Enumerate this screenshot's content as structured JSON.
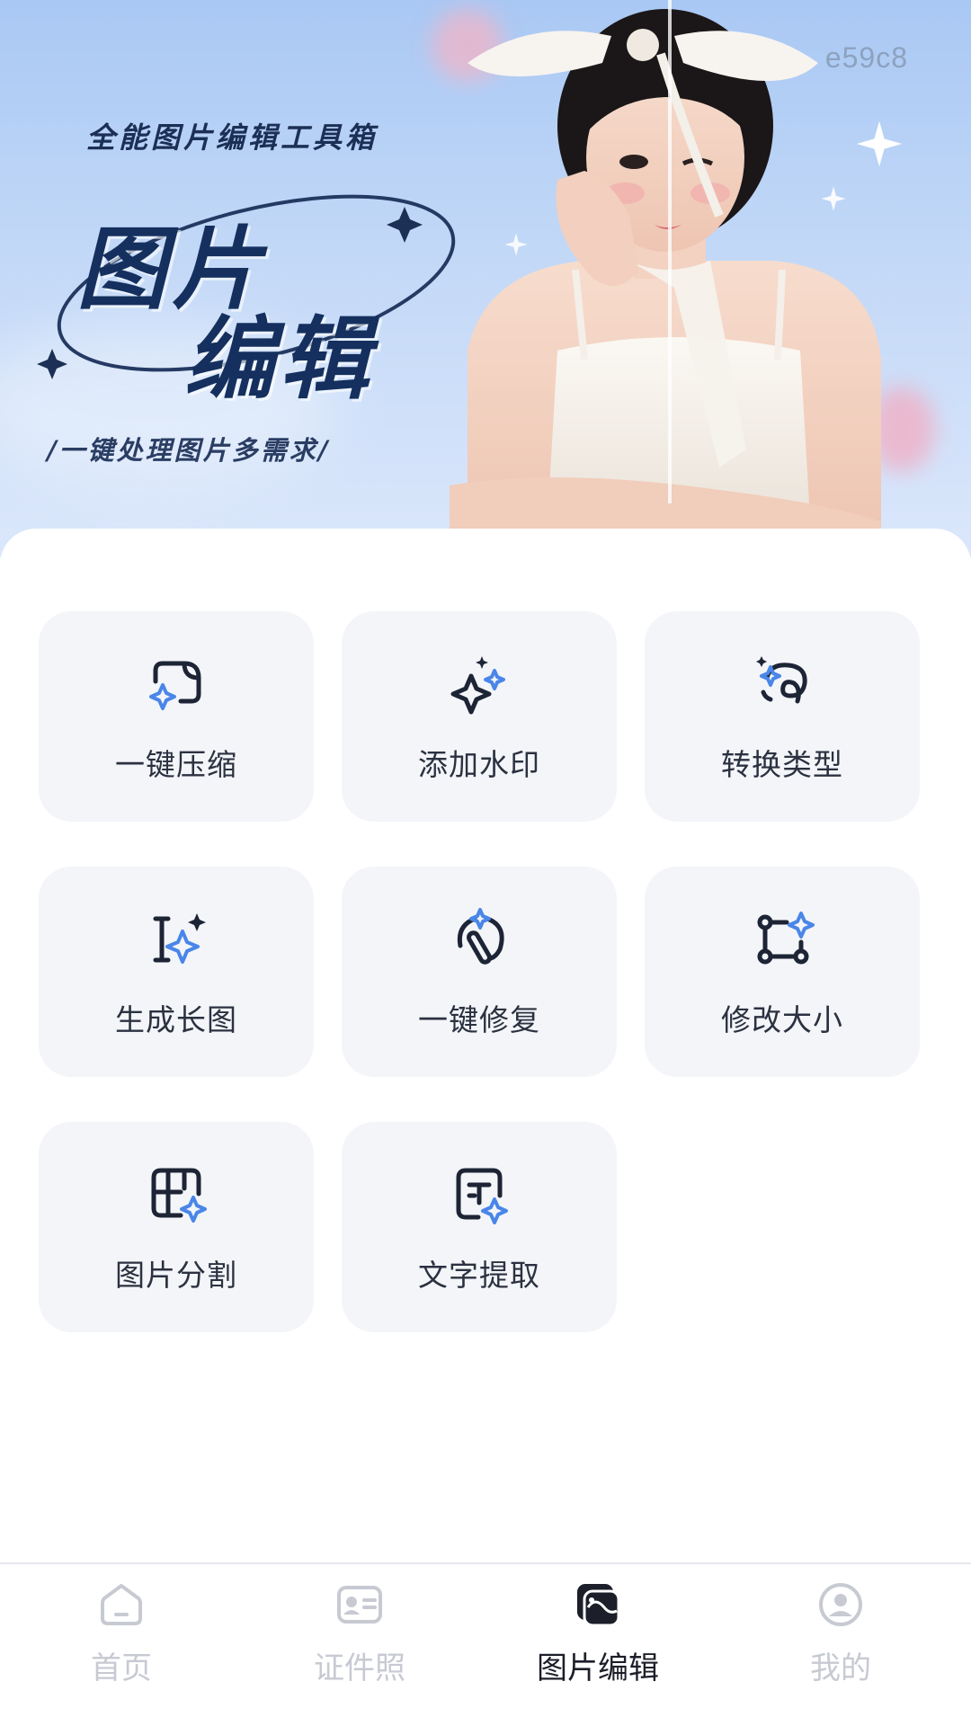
{
  "banner": {
    "code": "e59c8",
    "tagline": "全能图片编辑工具箱",
    "title_line1": "图片",
    "title_line2": "编辑",
    "slogan": "/一键处理图片多需求/"
  },
  "tools": [
    {
      "label": "一键压缩",
      "icon": "compress-icon"
    },
    {
      "label": "添加水印",
      "icon": "watermark-sparkle-icon"
    },
    {
      "label": "转换类型",
      "icon": "convert-icon"
    },
    {
      "label": "生成长图",
      "icon": "long-image-icon"
    },
    {
      "label": "一键修复",
      "icon": "repair-wand-icon"
    },
    {
      "label": "修改大小",
      "icon": "resize-icon"
    },
    {
      "label": "图片分割",
      "icon": "split-grid-icon"
    },
    {
      "label": "文字提取",
      "icon": "text-extract-icon"
    }
  ],
  "tabbar": {
    "items": [
      {
        "label": "首页",
        "icon": "home-icon",
        "active": false
      },
      {
        "label": "证件照",
        "icon": "id-card-icon",
        "active": false
      },
      {
        "label": "图片编辑",
        "icon": "image-edit-icon",
        "active": true
      },
      {
        "label": "我的",
        "icon": "profile-icon",
        "active": false
      }
    ]
  },
  "colors": {
    "accent_blue": "#4a86e8",
    "icon_dark": "#1d2435",
    "title_navy": "#15305e",
    "tile_bg": "#f3f5f9",
    "tab_inactive": "#c7cad2"
  }
}
